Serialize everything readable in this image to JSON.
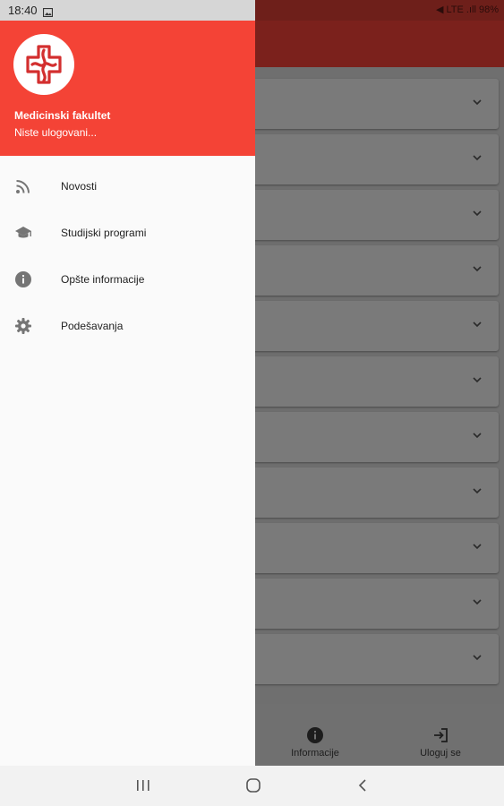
{
  "status_bar": {
    "time": "18:40",
    "right_text": "◀ LTE .ıll 98%"
  },
  "drawer": {
    "header": {
      "title": "Medicinski fakultet",
      "subtitle": "Niste ulogovani..."
    },
    "items": [
      {
        "label": "Novosti",
        "icon": "rss-feed-icon"
      },
      {
        "label": "Studijski programi",
        "icon": "school-icon"
      },
      {
        "label": "Opšte informacije",
        "icon": "info-icon"
      },
      {
        "label": "Podešavanja",
        "icon": "settings-icon"
      }
    ]
  },
  "bottom_nav": {
    "items": [
      {
        "label": "Informacije",
        "icon": "info-icon"
      },
      {
        "label": "Uloguj se",
        "icon": "login-icon"
      }
    ]
  },
  "colors": {
    "accent": "#f44336",
    "scrim_app_bar": "#7b211c"
  }
}
